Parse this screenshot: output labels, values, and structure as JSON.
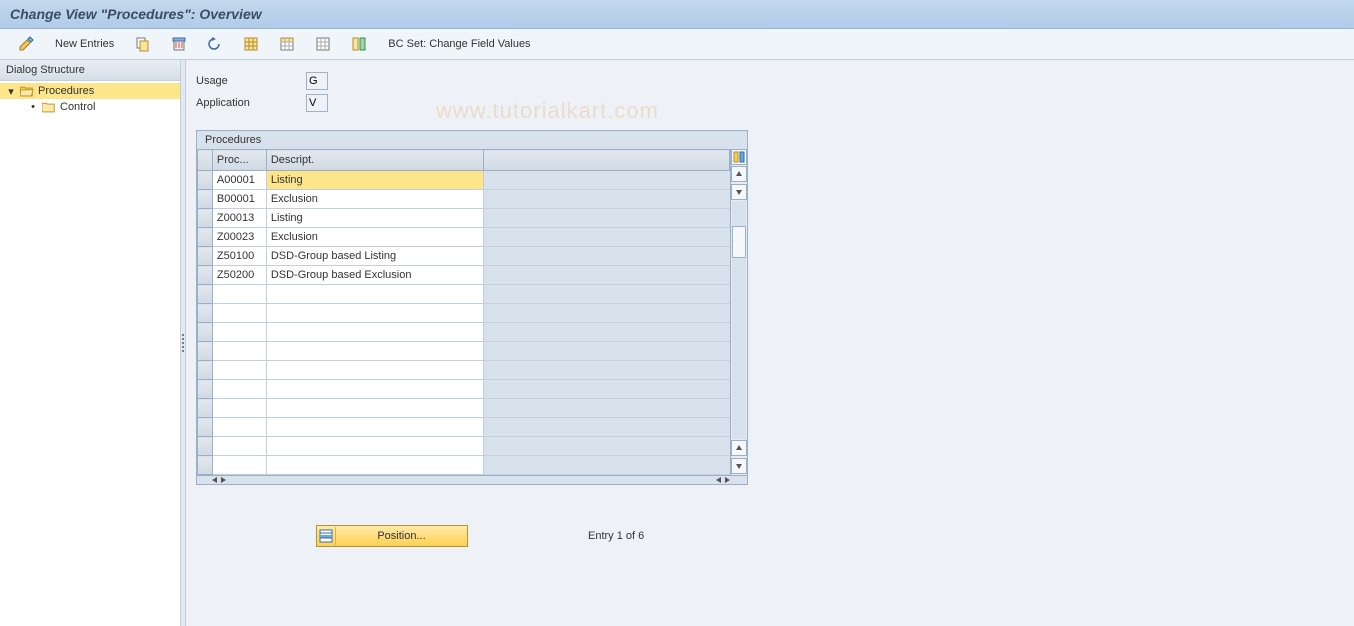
{
  "header": {
    "title": "Change View \"Procedures\": Overview"
  },
  "toolbar": {
    "new_entries_label": "New Entries",
    "bc_set_label": "BC Set: Change Field Values"
  },
  "sidebar": {
    "header": "Dialog Structure",
    "items": [
      {
        "label": "Procedures",
        "open": true,
        "selected": true
      },
      {
        "label": "Control",
        "open": false,
        "selected": false
      }
    ]
  },
  "fields": {
    "usage_label": "Usage",
    "usage_value": "G",
    "application_label": "Application",
    "application_value": "V"
  },
  "table": {
    "title": "Procedures",
    "columns": {
      "proc": "Proc...",
      "desc": "Descript."
    },
    "rows": [
      {
        "proc": "A00001",
        "desc": "Listing",
        "editing": true
      },
      {
        "proc": "B00001",
        "desc": "Exclusion"
      },
      {
        "proc": "Z00013",
        "desc": "Listing"
      },
      {
        "proc": "Z00023",
        "desc": "Exclusion"
      },
      {
        "proc": "Z50100",
        "desc": "DSD-Group based Listing"
      },
      {
        "proc": "Z50200",
        "desc": "DSD-Group based Exclusion"
      }
    ],
    "empty_rows": 10
  },
  "footer": {
    "position_label": "Position...",
    "entry_text": "Entry 1 of 6"
  },
  "watermark": "www.tutorialkart.com"
}
